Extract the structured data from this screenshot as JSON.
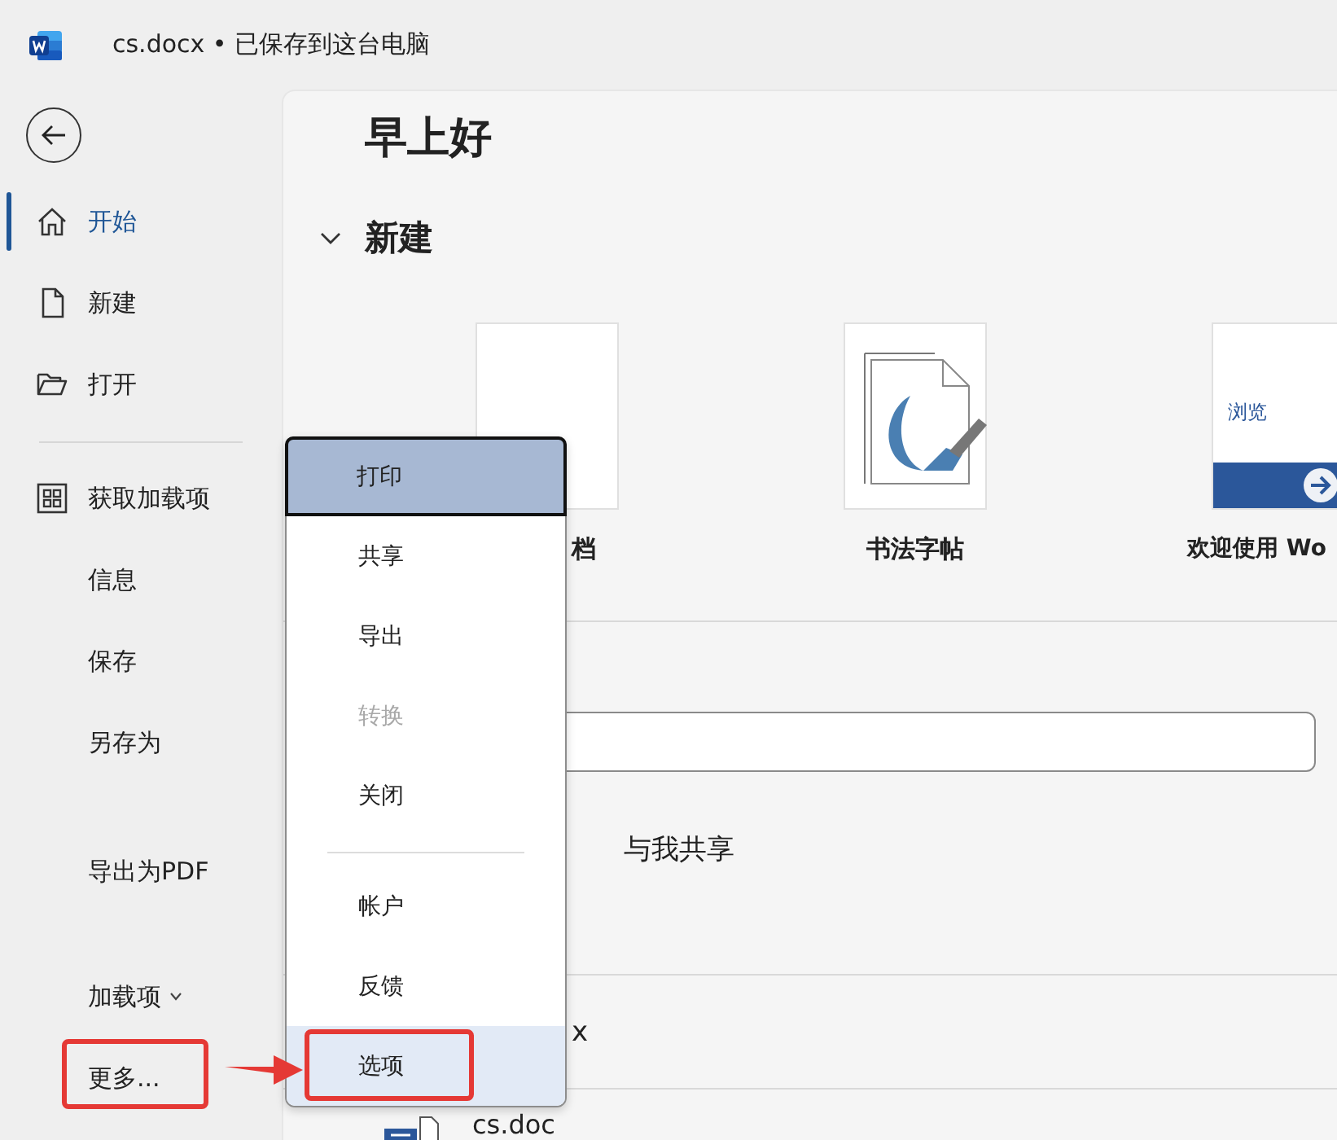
{
  "window": {
    "title": "cs.docx • 已保存到这台电脑"
  },
  "sidebar": {
    "items": [
      {
        "kind": "item",
        "label": "开始",
        "selected": true,
        "highlighted": false,
        "expandable": false
      },
      {
        "kind": "item",
        "label": "新建",
        "selected": false,
        "highlighted": false,
        "expandable": false
      },
      {
        "kind": "item",
        "label": "打开",
        "selected": false,
        "highlighted": false,
        "expandable": false
      },
      {
        "kind": "divider"
      },
      {
        "kind": "item",
        "label": "获取加载项",
        "selected": false,
        "highlighted": false,
        "expandable": false
      },
      {
        "kind": "item",
        "label": "信息",
        "selected": false,
        "highlighted": false,
        "expandable": false
      },
      {
        "kind": "item",
        "label": "保存",
        "selected": false,
        "highlighted": false,
        "expandable": false
      },
      {
        "kind": "item",
        "label": "另存为",
        "selected": false,
        "highlighted": false,
        "expandable": false
      },
      {
        "kind": "item",
        "label": "导出为PDF",
        "selected": false,
        "highlighted": false,
        "expandable": false
      },
      {
        "kind": "item",
        "label": "加载项",
        "selected": false,
        "highlighted": false,
        "expandable": true
      },
      {
        "kind": "item",
        "label": "更多...",
        "selected": false,
        "highlighted": true,
        "expandable": false
      }
    ]
  },
  "main": {
    "greeting": "早上好",
    "new_section": {
      "title": "新建",
      "expanded": true,
      "templates": [
        {
          "label": "档",
          "kind": "blank"
        },
        {
          "label": "书法字帖",
          "kind": "calligraphy"
        },
        {
          "label": "欢迎使用 Wo",
          "kind": "tour",
          "card_text": "浏览"
        }
      ]
    },
    "tabs": [
      {
        "label": "与我共享",
        "selected": false
      }
    ],
    "files": [
      {
        "name": "x",
        "kind": "hidden"
      },
      {
        "name": "cs.doc",
        "kind": "word"
      }
    ]
  },
  "menu": {
    "items": [
      {
        "kind": "item",
        "label": "打印",
        "selected": true,
        "disabled": false,
        "focused": false,
        "highlighted": false
      },
      {
        "kind": "item",
        "label": "共享",
        "selected": false,
        "disabled": false,
        "focused": false,
        "highlighted": false
      },
      {
        "kind": "item",
        "label": "导出",
        "selected": false,
        "disabled": false,
        "focused": false,
        "highlighted": false
      },
      {
        "kind": "item",
        "label": "转换",
        "selected": false,
        "disabled": true,
        "focused": false,
        "highlighted": false
      },
      {
        "kind": "item",
        "label": "关闭",
        "selected": false,
        "disabled": false,
        "focused": false,
        "highlighted": false
      },
      {
        "kind": "divider"
      },
      {
        "kind": "item",
        "label": "帐户",
        "selected": false,
        "disabled": false,
        "focused": false,
        "highlighted": false
      },
      {
        "kind": "item",
        "label": "反馈",
        "selected": false,
        "disabled": false,
        "focused": false,
        "highlighted": false
      },
      {
        "kind": "item",
        "label": "选项",
        "selected": false,
        "disabled": false,
        "focused": true,
        "highlighted": true
      }
    ]
  },
  "callout_arrow": true
}
